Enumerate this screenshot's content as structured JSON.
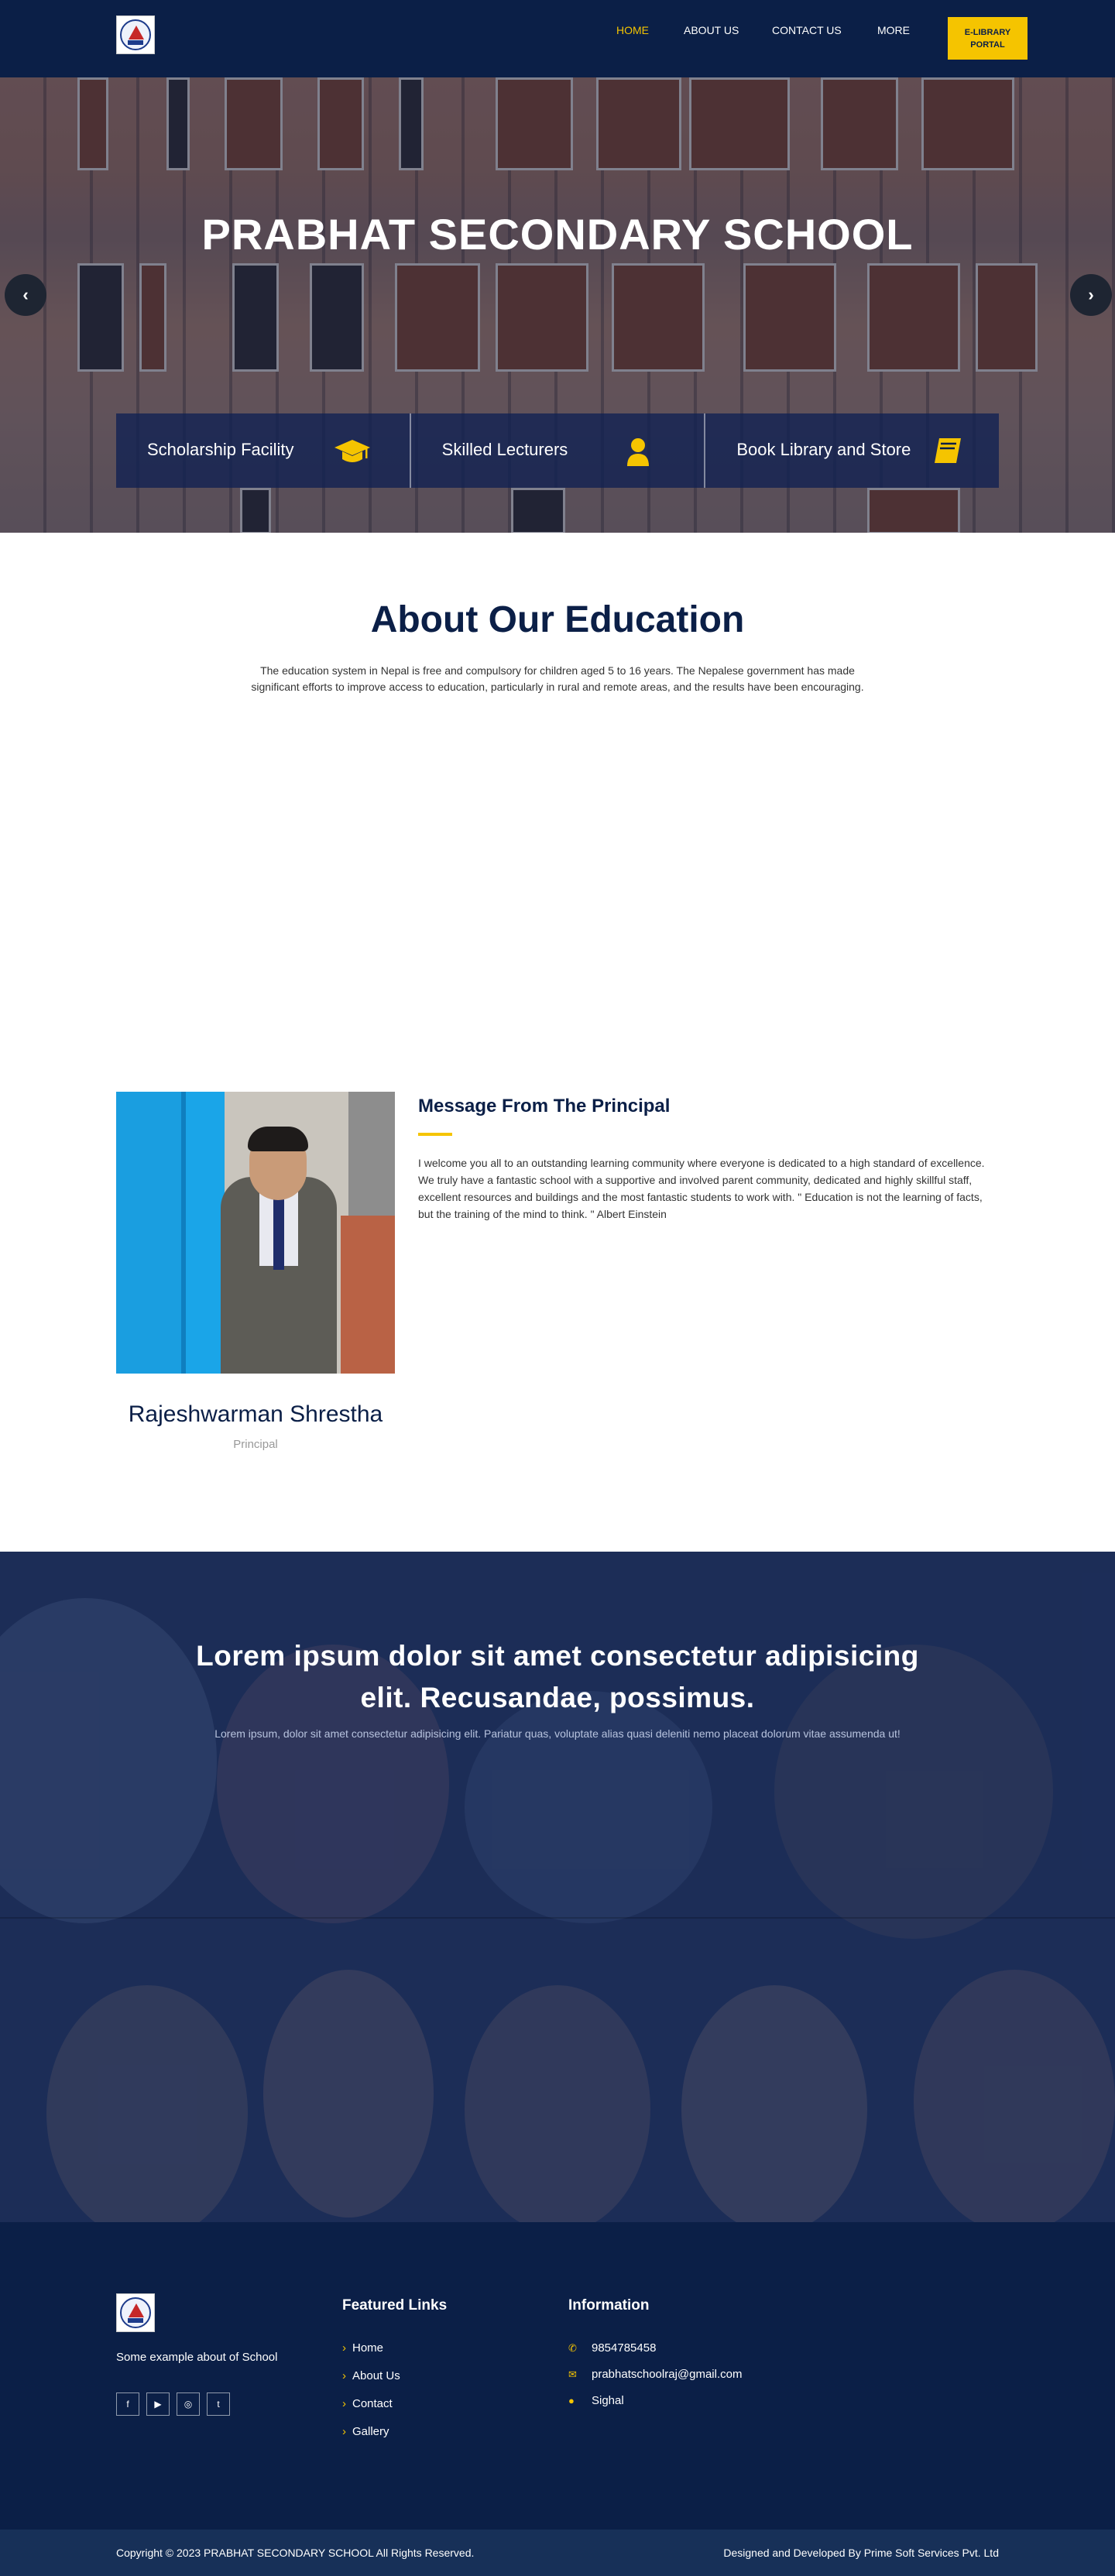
{
  "nav": {
    "links": [
      "HOME",
      "ABOUT US",
      "CONTACT US",
      "MORE"
    ],
    "active": "HOME",
    "elibrary": [
      "E-LIBRARY",
      "PORTAL"
    ],
    "icons": {
      "logo": "school-emblem-icon"
    }
  },
  "hero": {
    "title": "PRABHAT SECONDARY SCHOOL",
    "prev_icon": "chevron-left-icon",
    "next_icon": "chevron-right-icon",
    "features": [
      {
        "label": "Scholarship Facility",
        "icon": "graduation-cap-icon"
      },
      {
        "label": "Skilled Lecturers",
        "icon": "user-icon"
      },
      {
        "label": "Book Library and Store",
        "icon": "book-icon"
      }
    ]
  },
  "about": {
    "title": "About Our Education",
    "text": "The education system in Nepal is free and compulsory for children aged 5 to 16 years. The Nepalese government has made significant efforts to improve access to education, particularly in rural and remote areas, and the results have been encouraging."
  },
  "principal": {
    "name": "Rajeshwarman Shrestha",
    "role": "Principal",
    "message_title": "Message From The Principal",
    "message": "I welcome you all to an outstanding learning community where everyone is dedicated to a high standard of excellence. We truly have a fantastic school with a supportive and involved parent community, dedicated and highly skillful staff, excellent resources and buildings and the most fantastic students to work with. \" Education is not the learning of facts, but the training of the mind to think. \" Albert Einstein"
  },
  "band": {
    "title": "Lorem ipsum dolor sit amet consectetur adipisicing elit. Recusandae, possimus.",
    "subtitle": "Lorem ipsum, dolor sit amet consectetur adipisicing elit. Pariatur quas, voluptate alias quasi deleniti nemo placeat dolorum vitae assumenda ut!"
  },
  "footer": {
    "about": "Some example about of School",
    "socials": [
      "facebook-icon",
      "youtube-icon",
      "instagram-icon",
      "twitter-icon"
    ],
    "featured_heading": "Featured Links",
    "links": [
      "Home",
      "About Us",
      "Contact",
      "Gallery"
    ],
    "info_heading": "Information",
    "phone": "9854785458",
    "email": "prabhatschoolraj@gmail.com",
    "location": "Sighal",
    "info_icons": [
      "phone-icon",
      "envelope-icon",
      "map-marker-icon"
    ],
    "copyright": "Copyright © 2023 PRABHAT SECONDARY SCHOOL All Rights Reserved.",
    "developer": "Designed and Developed By Prime Soft Services Pvt. Ltd"
  },
  "colors": {
    "navy": "#0b1f47",
    "accent": "#f5c400",
    "bottom_bar": "#173058"
  }
}
